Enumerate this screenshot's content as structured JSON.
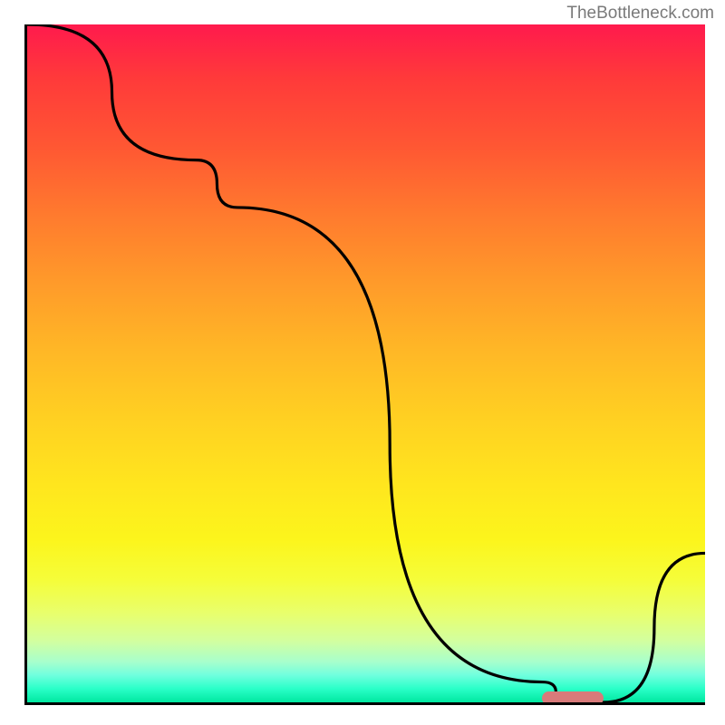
{
  "watermark": "TheBottleneck.com",
  "chart_data": {
    "type": "line",
    "x": [
      0,
      25,
      31,
      76,
      80,
      85,
      100
    ],
    "values": [
      100,
      80,
      73,
      3,
      0,
      0,
      22
    ],
    "title": "",
    "xlabel": "",
    "ylabel": "",
    "xlim": [
      0,
      100
    ],
    "ylim": [
      0,
      100
    ],
    "marker": {
      "x_start": 76,
      "x_end": 85,
      "y": 0
    },
    "background_gradient": {
      "stops": [
        {
          "pos": 0,
          "color": "#ff1a4d"
        },
        {
          "pos": 50,
          "color": "#ffd022"
        },
        {
          "pos": 100,
          "color": "#00e8a0"
        }
      ]
    }
  }
}
